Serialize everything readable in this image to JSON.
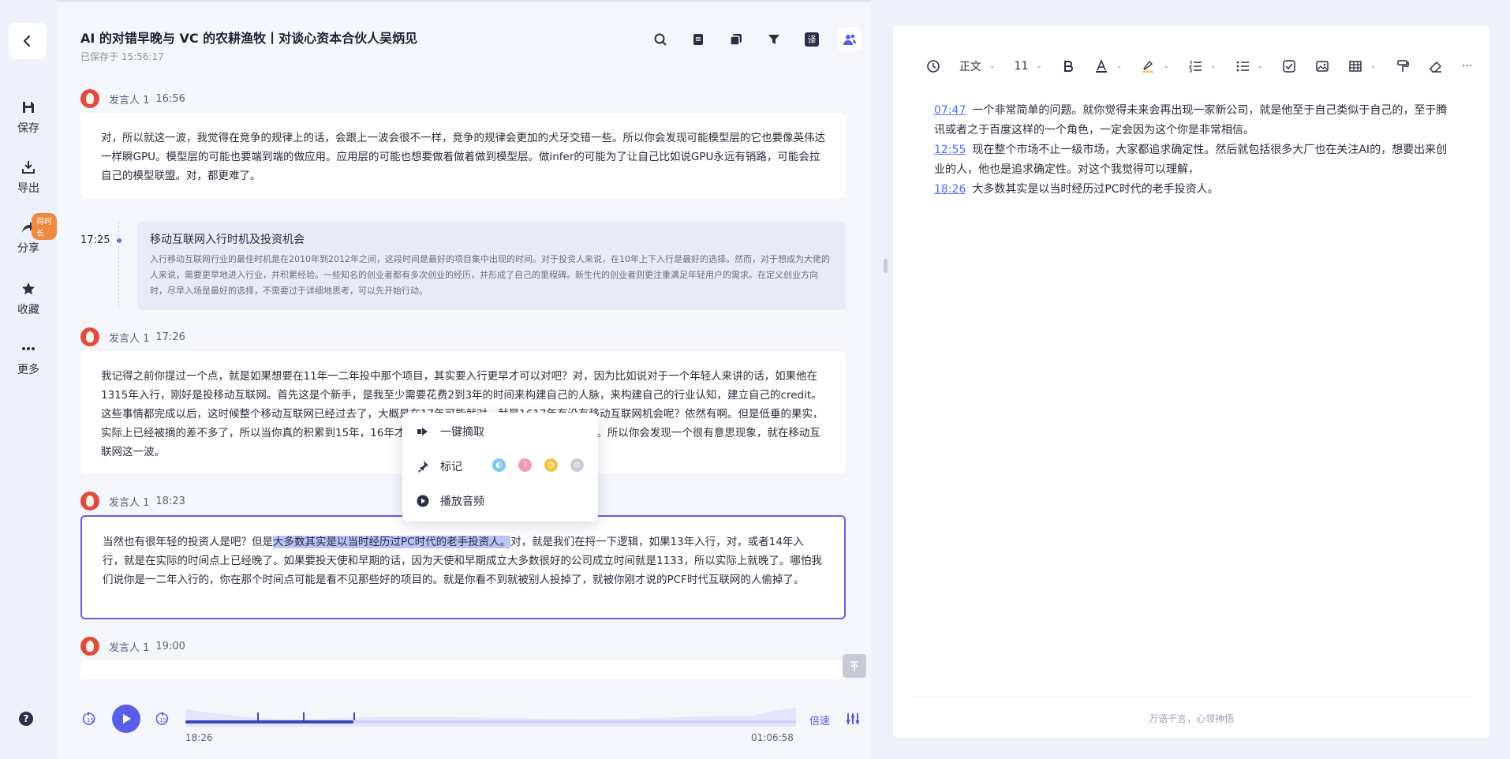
{
  "sidebar": {
    "items": [
      {
        "label": "保存",
        "icon": "save-icon"
      },
      {
        "label": "导出",
        "icon": "export-icon"
      },
      {
        "label": "分享",
        "icon": "share-icon"
      },
      {
        "label": "收藏",
        "icon": "star-icon"
      },
      {
        "label": "更多",
        "icon": "more-icon"
      }
    ],
    "share_badge": "得时长",
    "help_icon": "?"
  },
  "header": {
    "title": "AI 的对错早晚与 VC 的农耕渔牧丨对谈心资本合伙人吴炳见",
    "saved": "已保存于 15:56:17"
  },
  "toolbar": {
    "icons": [
      "search-icon",
      "summary-icon",
      "copy-icon",
      "filter-icon",
      "translate-icon",
      "speakers-icon"
    ],
    "translate_glyph": "译"
  },
  "transcript": {
    "blocks": [
      {
        "speaker": "发言人 1",
        "time": "16:56",
        "text": "对，所以就这一波，我觉得在竞争的规律上的话，会跟上一波会很不一样，竞争的规律会更加的犬牙交错一些。所以你会发现可能模型层的它也要像英伟达一样瞬GPU。模型层的可能也要端到端的做应用。应用层的可能也想要做着做着做到模型层。做infer的可能为了让自己比如说GPU永远有销路，可能会拉自己的模型联盟。对，都更难了。"
      },
      {
        "speaker": "发言人 1",
        "time": "17:26",
        "text": "我记得之前你提过一个点，就是如果想要在11年一二年投中那个项目，其实要入行更早才可以对吧？对，因为比如说对于一个年轻人来讲的话，如果他在1315年入行，刚好是投移动互联网。首先这是个新手，是我至少需要花费2到3年的时间来构建自己的人脉，来构建自己的行业认知，建立自己的credit。这些事情都完成以后，这时候整个移动互联网已经过去了，大概是在17年可能就对，就是1617年有没有移动互联网机会呢？依然有啊。但是低垂的果实，实际上已经被摘的差不多了，所以当你真的积累到15年，16年才能开始真的看到好项目和能推的这种项目。所以你会发现一个很有意思现象，就在移动互联网这一波。"
      },
      {
        "speaker": "发言人 1",
        "time": "18:23",
        "text_before": "当然也有很年轻的投资人是吧？但是",
        "text_highlight": "大多数其实是以当时经历过PC时代的老手投资人。",
        "text_after": "对，就是我们在捋一下逻辑，如果13年入行，对，或者14年入行，就是在实际的时间点上已经晚了。如果要投天使和早期的话，因为天使和早期成立大多数很好的公司成立时间就是1133，所以实际上就晚了。哪怕我们说你是一二年入行的，你在那个时间点可能是看不见那些好的项目的。就是你看不到就被别人投掉了，就被你刚才说的PCF时代互联网的人偷掉了。"
      },
      {
        "speaker": "发言人 1",
        "time": "19:00"
      }
    ],
    "chapter": {
      "time": "17:25",
      "title": "移动互联网入行时机及投资机会",
      "summary": "入行移动互联网行业的最佳时机是在2010年到2012年之间，这段时间是最好的项目集中出现的时间。对于投资人来说，在10年上下入行是最好的选择。然而，对于想成为大佬的人来说，需要更早地进入行业，并积累经验。一些知名的创业者都有多次创业的经历，并形成了自己的里程碑。新生代的创业者则更注重满足年轻用户的需求。在定义创业方向时，尽早入场是最好的选择，不需要过于详细地思考，可以先开始行动。"
    }
  },
  "context_menu": {
    "extract": "一键摘取",
    "mark": "标记",
    "play_audio": "播放音频",
    "mark_colors": [
      "#7ec8f0",
      "#f29ab8",
      "#f2c53d",
      "#c9ccd6"
    ]
  },
  "player": {
    "current_time": "18:26",
    "total_time": "01:06:58",
    "progress": 0.275,
    "speed_label": "倍速",
    "markers": [
      0.117,
      0.193,
      0.275
    ]
  },
  "editor": {
    "toolbar": {
      "style": "正文",
      "font_size": "11",
      "ellipsis": "···"
    },
    "notes": [
      {
        "time": "07:47",
        "text": "一个非常简单的问题。就你觉得未来会再出现一家新公司，就是他至于自己类似于自己的，至于腾讯或者之于百度这样的一个角色，一定会因为这个你是非常相信。"
      },
      {
        "time": "12:55",
        "text": "现在整个市场不止一级市场，大家都追求确定性。然后就包括很多大厂也在关注AI的，想要出来创业的人，他也是追求确定性。对这个我觉得可以理解，"
      },
      {
        "time": "18:26",
        "text": "大多数其实是以当时经历过PC时代的老手投资人。"
      }
    ],
    "footer": "万语千言，心领神悟"
  },
  "colors": {
    "accent": "#5a5ee6",
    "highlight": "#b8c4f5",
    "badge": "#f0883e"
  }
}
